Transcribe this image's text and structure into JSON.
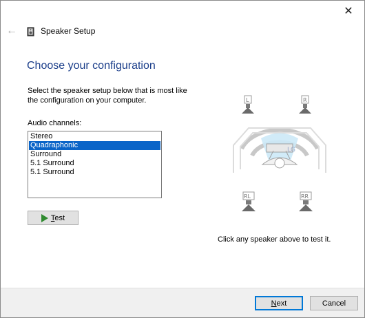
{
  "window": {
    "title": "Speaker Setup",
    "close_glyph": "✕",
    "back_glyph": "←"
  },
  "page": {
    "heading": "Choose your configuration",
    "instruction": "Select the speaker setup below that is most like the configuration on your computer.",
    "channels_label": "Audio channels:",
    "hint": "Click any speaker above to test it."
  },
  "channels": {
    "selected_index": 1,
    "items": [
      {
        "label": "Stereo"
      },
      {
        "label": "Quadraphonic"
      },
      {
        "label": "Surround"
      },
      {
        "label": "5.1 Surround"
      },
      {
        "label": "5.1 Surround"
      }
    ]
  },
  "test_button": {
    "mnemonic": "T",
    "rest": "est"
  },
  "footer": {
    "next_mnemonic": "N",
    "next_rest": "ext",
    "cancel_label": "Cancel"
  },
  "speakers": {
    "front_left": "L",
    "front_right": "R",
    "rear_left": "RL",
    "rear_right": "RR"
  },
  "colors": {
    "heading": "#1b3e8a",
    "selection": "#0a64c8",
    "accent_button_border": "#0078d7",
    "play_icon": "#2f8a2f"
  }
}
